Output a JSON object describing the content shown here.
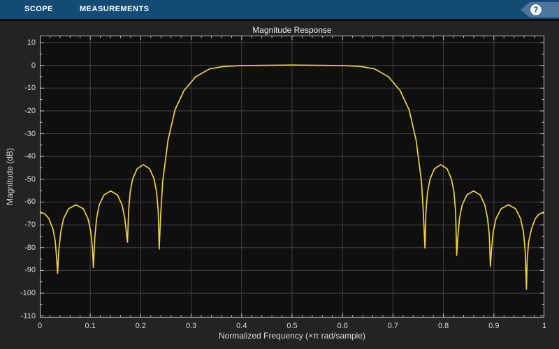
{
  "toolbar": {
    "tabs": [
      {
        "label": "SCOPE"
      },
      {
        "label": "MEASUREMENTS"
      }
    ],
    "help_glyph": "?"
  },
  "colors": {
    "toolbar_bg": "#134b75",
    "help_tag_bg": "#4c789d",
    "figure_bg": "#232323",
    "axes_bg": "#0f0f0f",
    "grid": "#404040",
    "axis_border": "#bdbdbd",
    "text": "#d9d9d9",
    "line": "#f0d045"
  },
  "chart_data": {
    "type": "line",
    "title": "Magnitude Response",
    "xlabel": "Normalized Frequency (×π rad/sample)",
    "ylabel": "Magnitude (dB)",
    "xlim": [
      0,
      1
    ],
    "ylim_display": [
      -110.7,
      13.05
    ],
    "x_ticks": [
      0,
      0.1,
      0.2,
      0.3,
      0.4,
      0.5,
      0.6,
      0.7,
      0.8,
      0.9,
      1
    ],
    "x_tick_labels": [
      "0",
      "0.1",
      "0.2",
      "0.3",
      "0.4",
      "0.5",
      "0.6",
      "0.7",
      "0.8",
      "0.9",
      "1"
    ],
    "y_ticks": [
      10,
      0,
      -10,
      -20,
      -30,
      -40,
      -50,
      -60,
      -70,
      -80,
      -90,
      -100,
      -110
    ],
    "y_tick_labels": [
      "10",
      "0",
      "-10",
      "-20",
      "-30",
      "-40",
      "-50",
      "-60",
      "-70",
      "-80",
      "-90",
      "-100",
      "-110"
    ],
    "x_minor_step": 0.02,
    "y_minor_step": 5,
    "grid": true,
    "legend_position": "none",
    "series": [
      {
        "color": "#f0d045",
        "points": [
          [
            0,
            -64.3
          ],
          [
            0.01,
            -65.2
          ],
          [
            0.018,
            -67.3
          ],
          [
            0.026,
            -71.8
          ],
          [
            0.0305,
            -77.0
          ],
          [
            0.0335,
            -85.0
          ],
          [
            0.0352,
            -91.3
          ],
          [
            0.0375,
            -81.5
          ],
          [
            0.0415,
            -73.1
          ],
          [
            0.047,
            -67.3
          ],
          [
            0.057,
            -62.9
          ],
          [
            0.0715,
            -61.2
          ],
          [
            0.086,
            -62.9
          ],
          [
            0.0955,
            -67.3
          ],
          [
            0.101,
            -73.1
          ],
          [
            0.1045,
            -81.0
          ],
          [
            0.1062,
            -88.7
          ],
          [
            0.109,
            -75.5
          ],
          [
            0.1125,
            -67.2
          ],
          [
            0.1175,
            -61.4
          ],
          [
            0.127,
            -56.9
          ],
          [
            0.1405,
            -55.1
          ],
          [
            0.154,
            -56.9
          ],
          [
            0.1632,
            -61.4
          ],
          [
            0.1685,
            -67.2
          ],
          [
            0.172,
            -74.5
          ],
          [
            0.1738,
            -77.6
          ],
          [
            0.176,
            -64.1
          ],
          [
            0.179,
            -55.7
          ],
          [
            0.184,
            -49.9
          ],
          [
            0.1928,
            -45.4
          ],
          [
            0.2052,
            -43.6
          ],
          [
            0.2178,
            -45.4
          ],
          [
            0.2265,
            -49.9
          ],
          [
            0.2315,
            -55.7
          ],
          [
            0.2347,
            -64.1
          ],
          [
            0.2366,
            -80.6
          ],
          [
            0.2395,
            -66.0
          ],
          [
            0.2435,
            -51.0
          ],
          [
            0.254,
            -33.0
          ],
          [
            0.268,
            -19.5
          ],
          [
            0.286,
            -11.0
          ],
          [
            0.309,
            -5.0
          ],
          [
            0.336,
            -1.6
          ],
          [
            0.364,
            -0.5
          ],
          [
            0.4,
            -0.1
          ],
          [
            0.45,
            0.0
          ],
          [
            0.5,
            0.1
          ],
          [
            0.55,
            0.0
          ],
          [
            0.6,
            -0.1
          ],
          [
            0.636,
            -0.5
          ],
          [
            0.664,
            -1.6
          ],
          [
            0.691,
            -5.0
          ],
          [
            0.714,
            -11.0
          ],
          [
            0.732,
            -19.5
          ],
          [
            0.746,
            -33.0
          ],
          [
            0.7565,
            -51.0
          ],
          [
            0.7605,
            -66.0
          ],
          [
            0.7634,
            -80.2
          ],
          [
            0.7653,
            -64.1
          ],
          [
            0.7685,
            -55.7
          ],
          [
            0.7735,
            -49.9
          ],
          [
            0.7822,
            -45.4
          ],
          [
            0.7948,
            -43.6
          ],
          [
            0.8072,
            -45.4
          ],
          [
            0.8159,
            -49.9
          ],
          [
            0.8209,
            -55.7
          ],
          [
            0.8241,
            -64.1
          ],
          [
            0.8263,
            -83.4
          ],
          [
            0.8285,
            -75.5
          ],
          [
            0.8318,
            -67.2
          ],
          [
            0.837,
            -61.4
          ],
          [
            0.8463,
            -56.9
          ],
          [
            0.8597,
            -55.1
          ],
          [
            0.873,
            -56.9
          ],
          [
            0.8822,
            -61.4
          ],
          [
            0.8875,
            -67.2
          ],
          [
            0.891,
            -74.5
          ],
          [
            0.8931,
            -88.2
          ],
          [
            0.8951,
            -81.5
          ],
          [
            0.8986,
            -73.1
          ],
          [
            0.9042,
            -67.3
          ],
          [
            0.9143,
            -62.9
          ],
          [
            0.9287,
            -61.2
          ],
          [
            0.943,
            -62.9
          ],
          [
            0.953,
            -67.3
          ],
          [
            0.9586,
            -73.1
          ],
          [
            0.9621,
            -81.5
          ],
          [
            0.9645,
            -98.3
          ],
          [
            0.966,
            -85.2
          ],
          [
            0.969,
            -77.4
          ],
          [
            0.9745,
            -71.8
          ],
          [
            0.982,
            -67.3
          ],
          [
            0.99,
            -65.2
          ],
          [
            1,
            -64.3
          ]
        ]
      }
    ]
  }
}
